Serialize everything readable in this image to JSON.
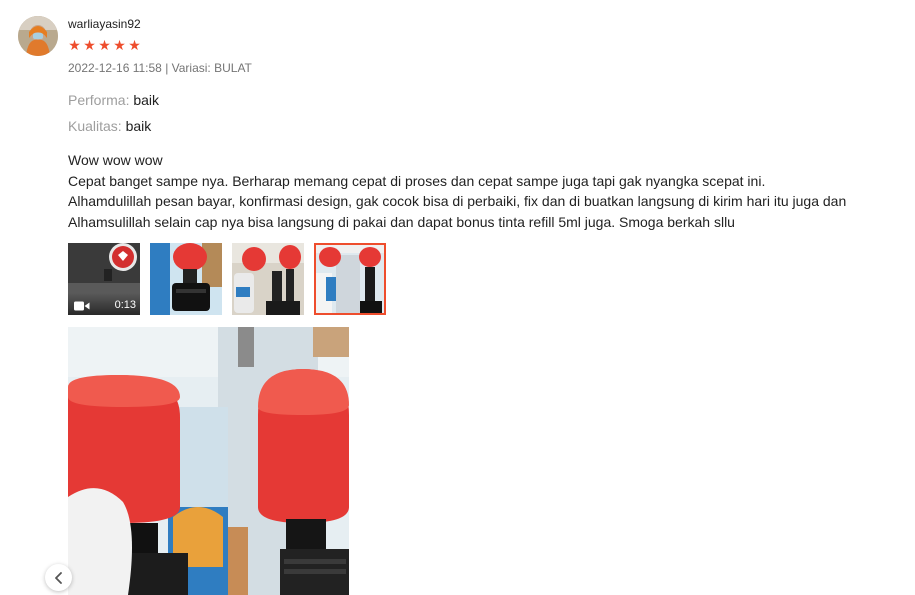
{
  "review": {
    "username": "warliayasin92",
    "rating": 5,
    "stars": [
      "★",
      "★",
      "★",
      "★",
      "★"
    ],
    "meta": "2022-12-16 11:58 | Variasi: BULAT",
    "attributes": [
      {
        "key": "Performa:",
        "value": "baik"
      },
      {
        "key": "Kualitas:",
        "value": "baik"
      }
    ],
    "body_lines": [
      "Wow wow wow",
      "Cepat banget sampe nya. Berharap memang cepat di proses dan cepat sampe juga tapi gak nyangka scepat ini.",
      "Alhamdulillah pesan bayar, konfirmasi design, gak cocok bisa di perbaiki, fix dan di buatkan langsung di kirim hari itu juga dan",
      "Alhamsulillah selain cap nya bisa langsung di pakai dan dapat bonus tinta refill 5ml juga. Smoga berkah sllu"
    ],
    "media": {
      "video_duration": "0:13",
      "selected_index": 3,
      "count": 4
    }
  },
  "colors": {
    "accent": "#ee4d2d",
    "muted": "#757575",
    "label": "#9e9e9e",
    "text": "#222222"
  },
  "icons": {
    "video": "video-camera-icon",
    "prev": "chevron-left-icon"
  }
}
